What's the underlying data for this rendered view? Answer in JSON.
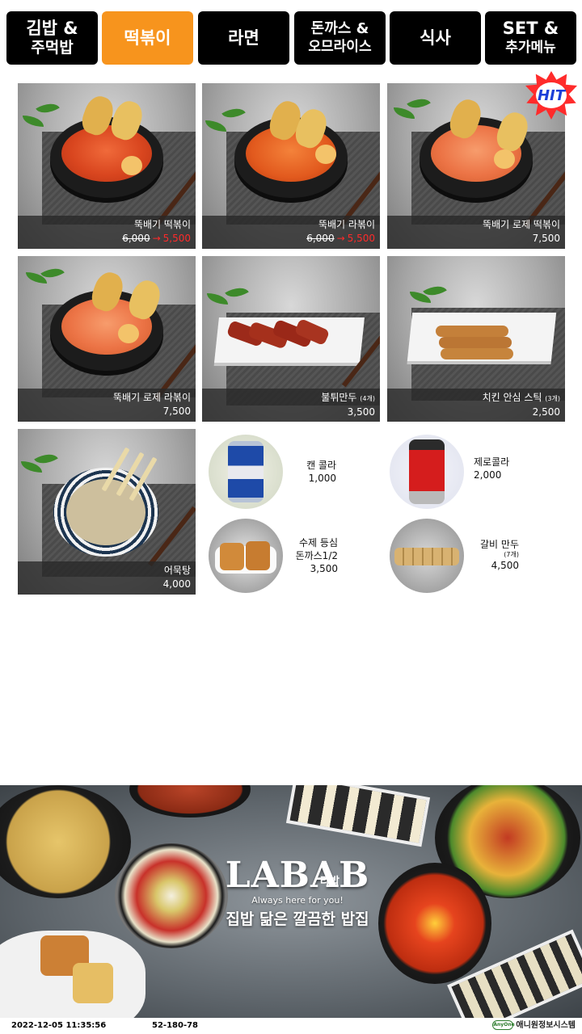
{
  "tabs": [
    {
      "l1": "김밥 &",
      "l2": "주먹밥",
      "active": false
    },
    {
      "l1": "떡볶이",
      "l2": "",
      "active": true
    },
    {
      "l1": "라면",
      "l2": "",
      "active": false
    },
    {
      "l1": "돈까스 &",
      "l2": "오므라이스",
      "active": false
    },
    {
      "l1": "식사",
      "l2": "",
      "active": false
    },
    {
      "l1": "SET &",
      "l2": "추가메뉴",
      "active": false
    }
  ],
  "badge": {
    "hit": "HIT"
  },
  "items": [
    {
      "name": "뚝배기 떡볶이",
      "sub": "",
      "price_old": "6,000",
      "arrow": "→",
      "price": "5,500"
    },
    {
      "name": "뚝배기 라볶이",
      "sub": "",
      "price_old": "6,000",
      "arrow": "→",
      "price": "5,500"
    },
    {
      "name": "뚝배기 로제 떡볶이",
      "sub": "",
      "price_old": "",
      "arrow": "",
      "price": "7,500"
    },
    {
      "name": "뚝배기 로제 라볶이",
      "sub": "",
      "price_old": "",
      "arrow": "",
      "price": "7,500"
    },
    {
      "name": "불튀만두",
      "sub": "(4개)",
      "price_old": "",
      "arrow": "",
      "price": "3,500"
    },
    {
      "name": "치킨 안심 스틱",
      "sub": "(3개)",
      "price_old": "",
      "arrow": "",
      "price": "2,500"
    },
    {
      "name": "어묵탕",
      "sub": "",
      "price_old": "",
      "arrow": "",
      "price": "4,000"
    }
  ],
  "small_items": [
    {
      "name": "캔 콜라",
      "name2": "",
      "sub": "",
      "price": "1,000"
    },
    {
      "name": "제로콜라",
      "name2": "",
      "sub": "",
      "price": "2,000"
    },
    {
      "name": "수제 등심",
      "name2": "돈까스1/2",
      "sub": "",
      "price": "3,500"
    },
    {
      "name": "갈비 만두",
      "name2": "",
      "sub": "(7개)",
      "price": "4,500"
    }
  ],
  "banner": {
    "logo": "LABAB",
    "logo_kr": "라밥",
    "slogan": "Always here for you!",
    "tagline": "집밥 닮은 깔끔한 밥집"
  },
  "status": {
    "datetime": "2022-12-05 11:35:56",
    "code": "52-180-78",
    "vendor_mark": "AnyOne",
    "vendor": "애니원정보시스템"
  },
  "colors": {
    "active_tab": "#f7941d",
    "tab": "#000000",
    "sale_price": "#ff2a2a"
  }
}
